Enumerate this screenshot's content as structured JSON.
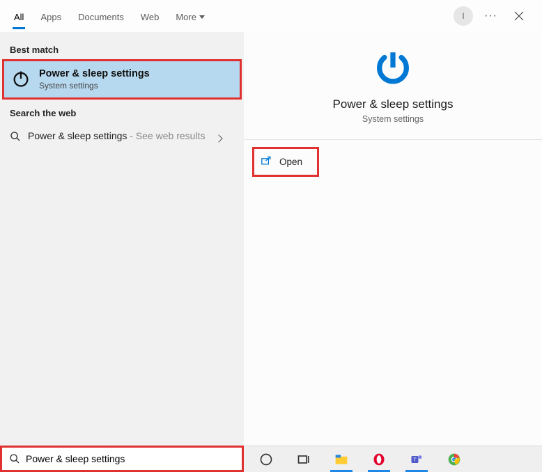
{
  "header": {
    "tabs": [
      "All",
      "Apps",
      "Documents",
      "Web",
      "More"
    ],
    "avatar_letter": "I"
  },
  "left": {
    "section_best_match": "Best match",
    "best_match": {
      "title": "Power & sleep settings",
      "subtitle": "System settings"
    },
    "section_search_web": "Search the web",
    "web_item": {
      "title": "Power & sleep settings",
      "suffix": " - See web results"
    }
  },
  "right": {
    "hero_title": "Power & sleep settings",
    "hero_subtitle": "System settings",
    "open_label": "Open"
  },
  "search": {
    "value": "Power & sleep settings"
  }
}
